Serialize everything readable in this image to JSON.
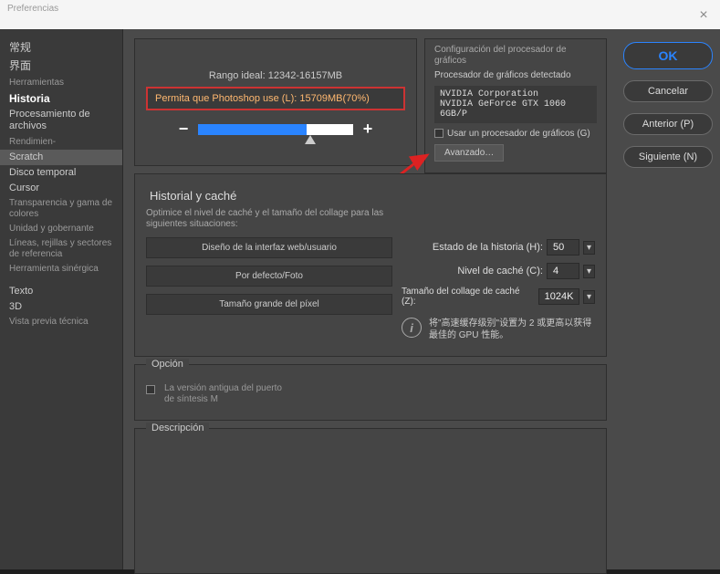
{
  "window": {
    "title": "Preferencias"
  },
  "sidebar": {
    "items": [
      {
        "label": "常规",
        "cls": "cjk"
      },
      {
        "label": "界面",
        "cls": "cjk"
      },
      {
        "label": "Herramientas",
        "cls": "small"
      },
      {
        "label": "Historia",
        "cls": "bold"
      },
      {
        "label": "Procesamiento de archivos",
        "cls": ""
      },
      {
        "label": "Rendimien-",
        "cls": "small"
      },
      {
        "label": "Scratch",
        "cls": "selected"
      },
      {
        "label": "Disco temporal",
        "cls": ""
      },
      {
        "label": "Cursor",
        "cls": ""
      },
      {
        "label": "Transparencia y gama de colores",
        "cls": "small"
      },
      {
        "label": "Unidad y gobernante",
        "cls": "small"
      },
      {
        "label": "Líneas, rejillas y sectores de referencia",
        "cls": "small"
      },
      {
        "label": "Herramienta sinérgica",
        "cls": "small"
      },
      {
        "label": "Texto",
        "cls": ""
      },
      {
        "label": "3D",
        "cls": ""
      },
      {
        "label": "Vista previa técnica",
        "cls": "small"
      }
    ]
  },
  "memory": {
    "ideal": "Rango ideal: 12342-16157MB",
    "allow": "Permita que Photoshop use (L): 15709MB(70%)",
    "minus": "−",
    "plus": "+"
  },
  "gpu": {
    "heading": "Configuración del procesador de gráficos",
    "detected": "Procesador de gráficos detectado",
    "vendor": "NVIDIA Corporation",
    "model": "NVIDIA GeForce GTX 1060 6GB/P",
    "use": "Usar un procesador de gráficos (G)",
    "advanced": "Avanzado…"
  },
  "history": {
    "title": "Historial y caché",
    "sub": "Optimice el nivel de caché y el tamaño del collage para las siguientes situaciones:",
    "btn1": "Diseño de la interfaz web/usuario",
    "btn2": "Por defecto/Foto",
    "btn3": "Tamaño grande del píxel",
    "state_label": "Estado de la historia (H):",
    "state_val": "50",
    "cache_label": "Nivel de caché (C):",
    "cache_val": "4",
    "tile_label": "Tamaño del collage de caché (Z):",
    "tile_val": "1024K",
    "info": "将\"高速缓存级别\"设置为 2 或更高以获得最佳的 GPU 性能。"
  },
  "option": {
    "title": "Opción",
    "legacy": "La versión antigua del puerto de síntesis M"
  },
  "desc": {
    "title": "Descripción"
  },
  "buttons": {
    "ok": "OK",
    "cancel": "Cancelar",
    "prev": "Anterior (P)",
    "next": "Siguiente (N)"
  }
}
